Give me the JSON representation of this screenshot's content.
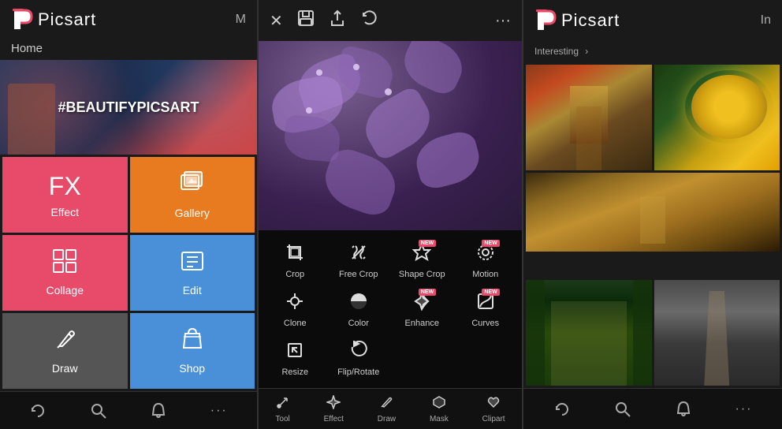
{
  "panel1": {
    "app_title": "Picsart",
    "header_extra": "M",
    "section_title": "Home",
    "banner_hashtag": "#BEAUTIFYPICSART",
    "tiles": [
      {
        "id": "effect",
        "label": "Effect",
        "icon": "FX",
        "color": "#e84a6a"
      },
      {
        "id": "gallery",
        "label": "Gallery",
        "icon": "🖼",
        "color": "#e87a20"
      },
      {
        "id": "collage",
        "label": "Collage",
        "icon": "⊞",
        "color": "#e84a6a"
      },
      {
        "id": "edit",
        "label": "Edit",
        "icon": "🖨",
        "color": "#4a90d9"
      },
      {
        "id": "draw",
        "label": "Draw",
        "icon": "✏",
        "color": "#555"
      },
      {
        "id": "shop",
        "label": "Shop",
        "icon": "🛍",
        "color": "#4a90d9"
      }
    ],
    "nav": [
      {
        "id": "refresh",
        "icon": "↺"
      },
      {
        "id": "search",
        "icon": "⊙"
      },
      {
        "id": "bell",
        "icon": "🔔"
      },
      {
        "id": "more",
        "icon": "···"
      }
    ]
  },
  "panel2": {
    "header_buttons": [
      {
        "id": "close",
        "icon": "✕"
      },
      {
        "id": "save",
        "icon": "💾"
      },
      {
        "id": "share",
        "icon": "⤴"
      },
      {
        "id": "undo",
        "icon": "↩"
      },
      {
        "id": "more",
        "icon": "···"
      }
    ],
    "tools": [
      {
        "id": "crop",
        "label": "Crop",
        "icon": "⊡",
        "new": false
      },
      {
        "id": "free-crop",
        "label": "Free Crop",
        "icon": "✂",
        "new": false
      },
      {
        "id": "shape-crop",
        "label": "Shape Crop",
        "icon": "⭐",
        "new": true
      },
      {
        "id": "motion",
        "label": "Motion",
        "icon": "◎",
        "new": true
      },
      {
        "id": "clone",
        "label": "Clone",
        "icon": "⊕",
        "new": false
      },
      {
        "id": "color",
        "label": "Color",
        "icon": "◑",
        "new": false
      },
      {
        "id": "enhance",
        "label": "Enhance",
        "icon": "⟲",
        "new": true
      },
      {
        "id": "curves",
        "label": "Curves",
        "icon": "⌇",
        "new": true
      },
      {
        "id": "resize",
        "label": "Resize",
        "icon": "⤡",
        "new": false
      },
      {
        "id": "flip-rotate",
        "label": "Flip/Rotate",
        "icon": "↻",
        "new": false
      }
    ],
    "bottom_tabs": [
      {
        "id": "tool",
        "label": "Tool",
        "icon": "🔧"
      },
      {
        "id": "effect",
        "label": "Effect",
        "icon": "✨"
      },
      {
        "id": "draw",
        "label": "Draw",
        "icon": "✏"
      },
      {
        "id": "mask",
        "label": "Mask",
        "icon": "◆"
      },
      {
        "id": "clipart",
        "label": "Clipart",
        "icon": "♥"
      }
    ]
  },
  "panel3": {
    "app_title": "Picsart",
    "section_title": "Interesting",
    "section_arrow": "›",
    "header_extra": "In",
    "photos": [
      {
        "id": "autumn-road",
        "alt": "Autumn road"
      },
      {
        "id": "sunflower",
        "alt": "Sunflower"
      },
      {
        "id": "golden-path",
        "alt": "Golden path"
      },
      {
        "id": "forest",
        "alt": "Forest"
      },
      {
        "id": "rails",
        "alt": "Rails"
      }
    ],
    "nav": [
      {
        "id": "refresh",
        "icon": "↺"
      },
      {
        "id": "search",
        "icon": "⊙"
      },
      {
        "id": "bell",
        "icon": "🔔"
      },
      {
        "id": "more",
        "icon": "···"
      }
    ]
  }
}
